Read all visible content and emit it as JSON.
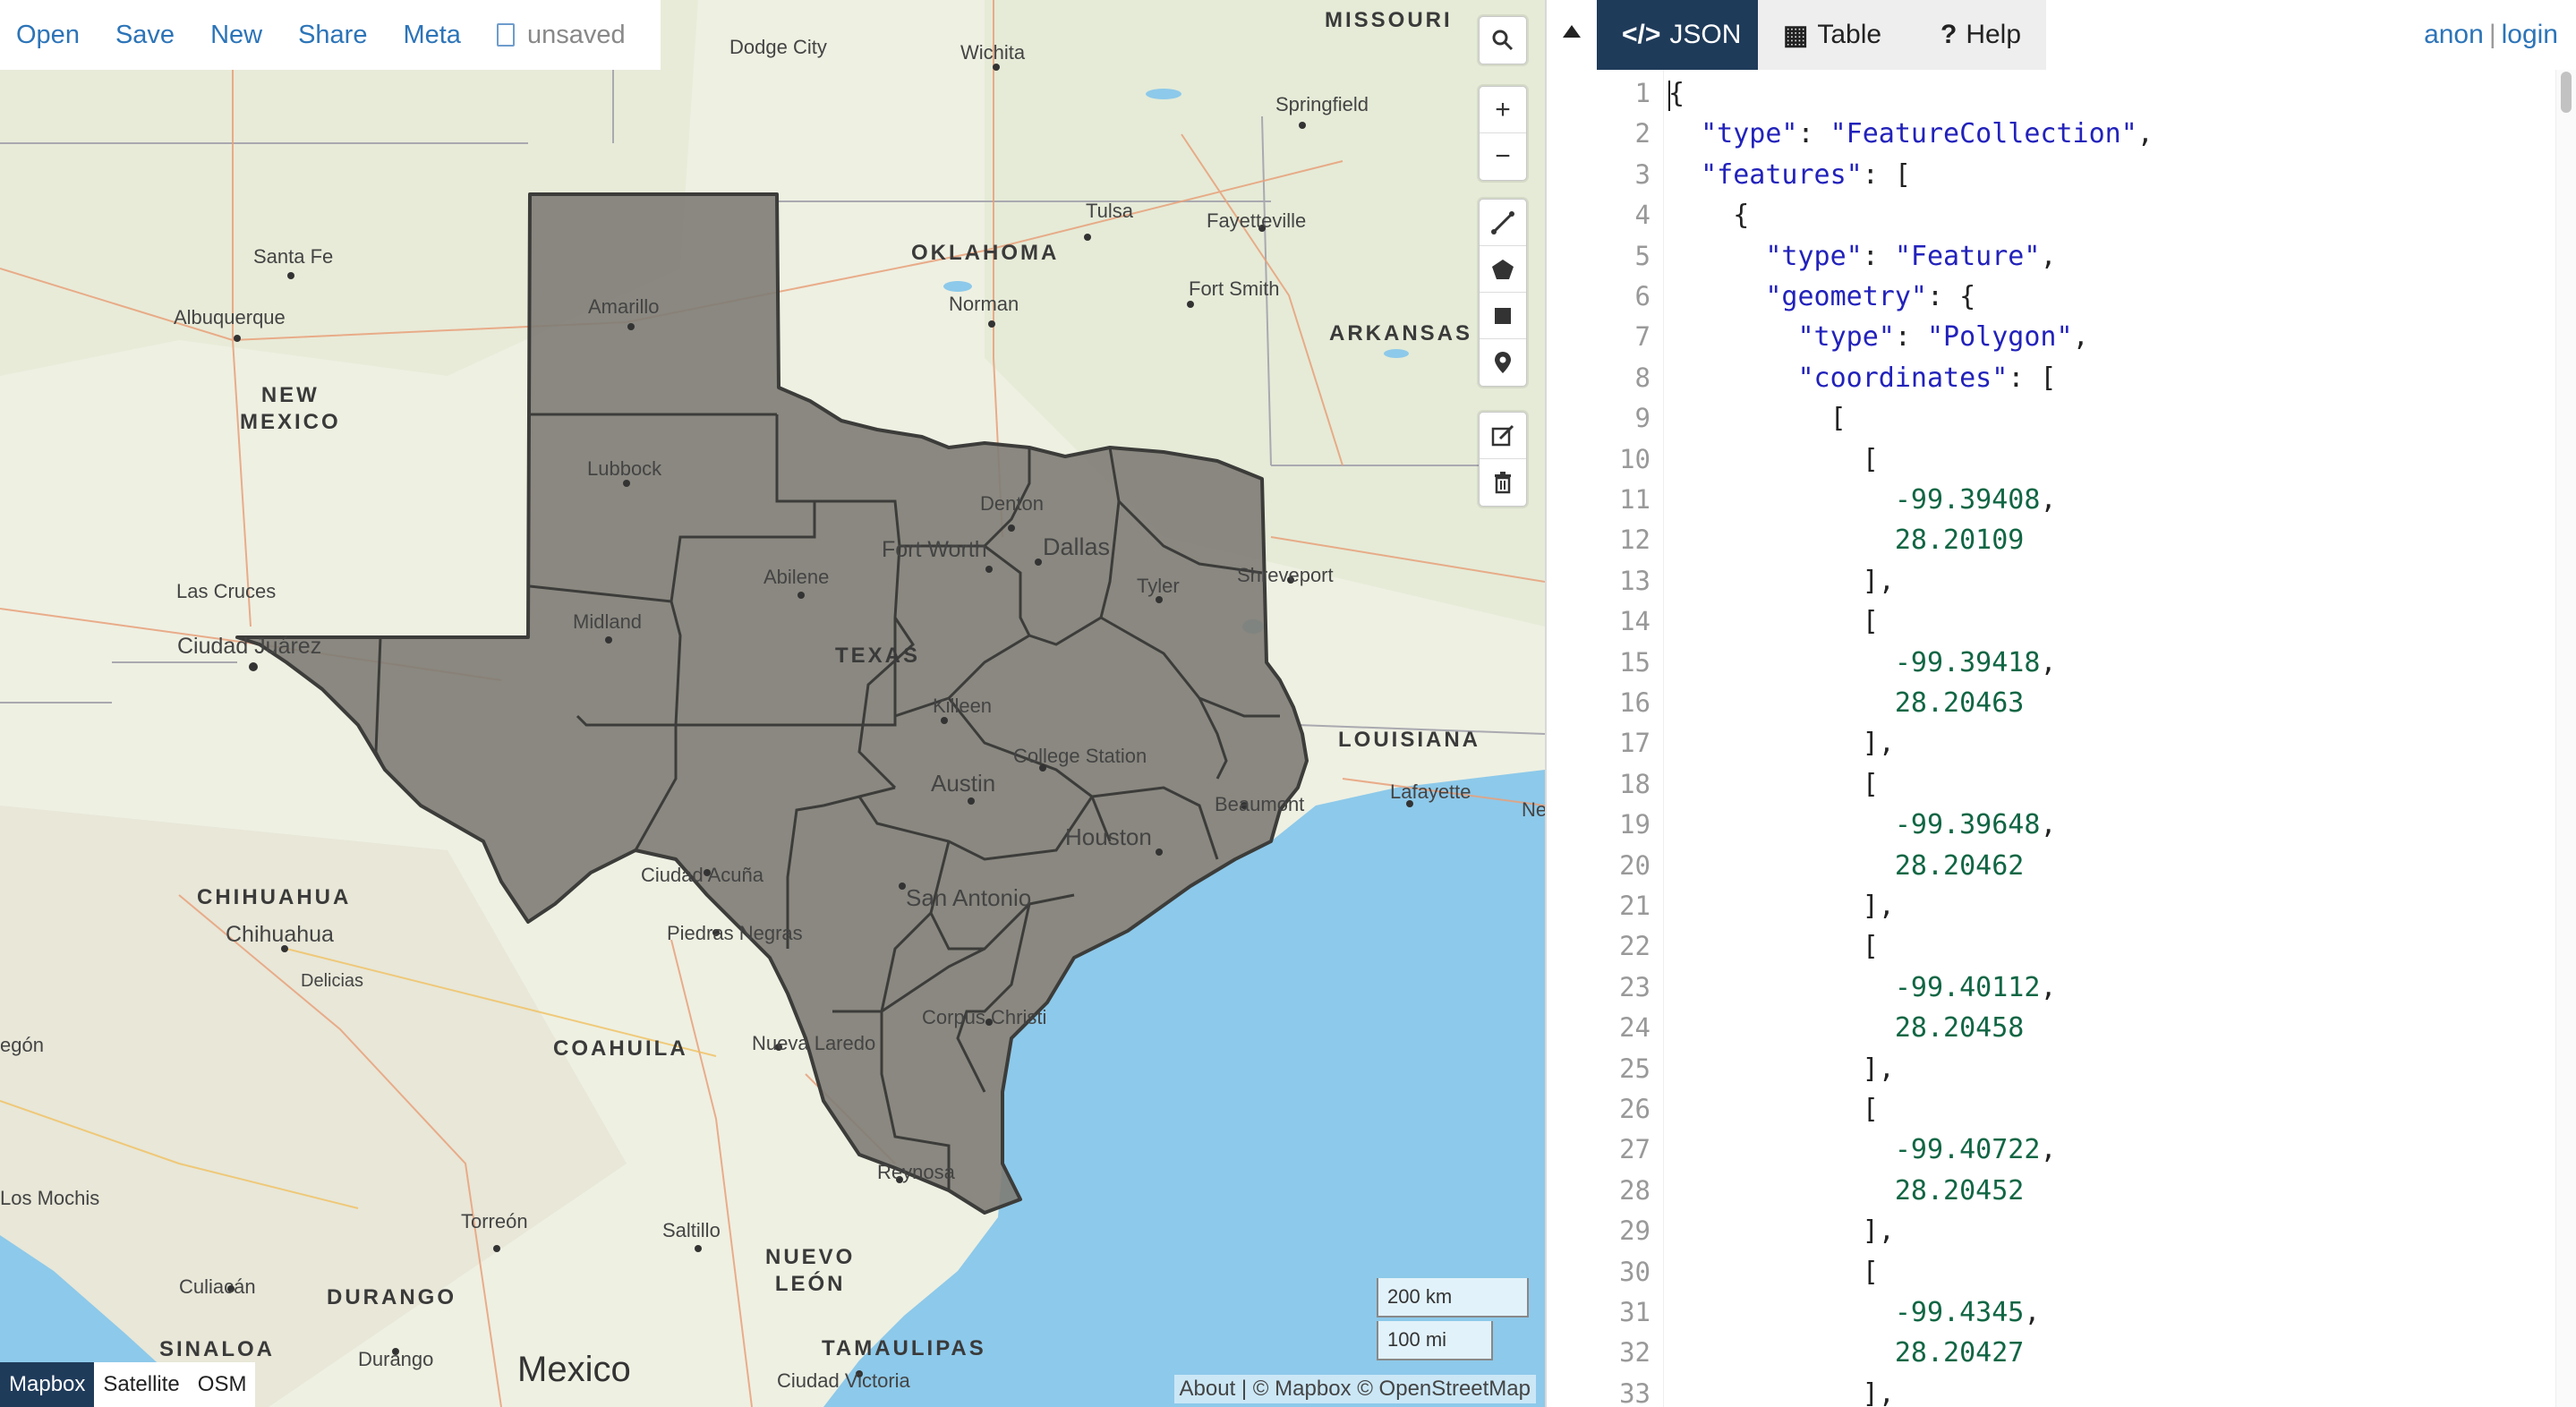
{
  "menu": {
    "items": [
      "Open",
      "Save",
      "New",
      "Share",
      "Meta"
    ],
    "status": "unsaved"
  },
  "map": {
    "labels": {
      "states": [
        "NEW\nMEXICO",
        "OKLAHOMA",
        "ARKANSAS",
        "TEXAS",
        "LOUISIANA",
        "MISSOURI",
        "CHIHUAHUA",
        "COAHUILA",
        "NUEVO\nLEÓN",
        "DURANGO",
        "TAMAULIPAS",
        "SINALOA"
      ],
      "country": "Mexico",
      "cities": [
        "Dodge City",
        "Wichita",
        "Springfield",
        "Tulsa",
        "Fayetteville",
        "Santa Fe",
        "Albuquerque",
        "Amarillo",
        "Norman",
        "Fort Smith",
        "Lubbock",
        "Denton",
        "Fort Worth",
        "Dallas",
        "Tyler",
        "Shreveport",
        "Abilene",
        "Las Cruces",
        "Ciudad Juárez",
        "Midland",
        "Killeen",
        "College Station",
        "Austin",
        "Beaumont",
        "Lafayette",
        "Houston",
        "Ciudad Acuña",
        "San Antonio",
        "Chihuahua",
        "Piedras Negras",
        "Delicias",
        "Nueva Laredo",
        "Corpus Christi",
        "Reynosa",
        "Torreón",
        "Saltillo",
        "Culiacán",
        "Durango",
        "Ciudad Victoria",
        "Los Mochis",
        "egón",
        "Ne"
      ]
    },
    "controls": {
      "search": "search-icon",
      "zoom_in": "+",
      "zoom_out": "−"
    },
    "scale": {
      "km": "200 km",
      "mi": "100 mi"
    },
    "layers": [
      "Mapbox",
      "Satellite",
      "OSM"
    ],
    "active_layer": "Mapbox",
    "attribution": "About | © Mapbox © OpenStreetMap",
    "colors": {
      "water": "#8dc9ea",
      "land": "#eef0e2",
      "selection_fill": "#7e7c76",
      "selection_stroke": "#3c3c3a"
    }
  },
  "pane": {
    "tabs": [
      {
        "icon": "</>",
        "label": "JSON",
        "active": true
      },
      {
        "icon": "▦",
        "label": "Table",
        "active": false
      },
      {
        "icon": "?",
        "label": "Help",
        "active": false
      }
    ],
    "auth": {
      "anon": "anon",
      "separator": "|",
      "login": "login"
    },
    "editor": {
      "line_numbers": [
        "1",
        "2",
        "3",
        "4",
        "5",
        "6",
        "7",
        "8",
        "9",
        "10",
        "11",
        "12",
        "13",
        "14",
        "15",
        "16",
        "17",
        "18",
        "19",
        "20",
        "21",
        "22",
        "23",
        "24",
        "25",
        "26",
        "27",
        "28",
        "29",
        "30",
        "31",
        "32",
        "33"
      ],
      "lines": [
        "{",
        "  \"type\": \"FeatureCollection\",",
        "  \"features\": [",
        "    {",
        "      \"type\": \"Feature\",",
        "      \"geometry\": {",
        "        \"type\": \"Polygon\",",
        "        \"coordinates\": [",
        "          [",
        "            [",
        "              -99.39408,",
        "              28.20109",
        "            ],",
        "            [",
        "              -99.39418,",
        "              28.20463",
        "            ],",
        "            [",
        "              -99.39648,",
        "              28.20462",
        "            ],",
        "            [",
        "              -99.40112,",
        "              28.20458",
        "            ],",
        "            [",
        "              -99.40722,",
        "              28.20452",
        "            ],",
        "            [",
        "              -99.4345,",
        "              28.20427",
        "            ],"
      ]
    }
  }
}
